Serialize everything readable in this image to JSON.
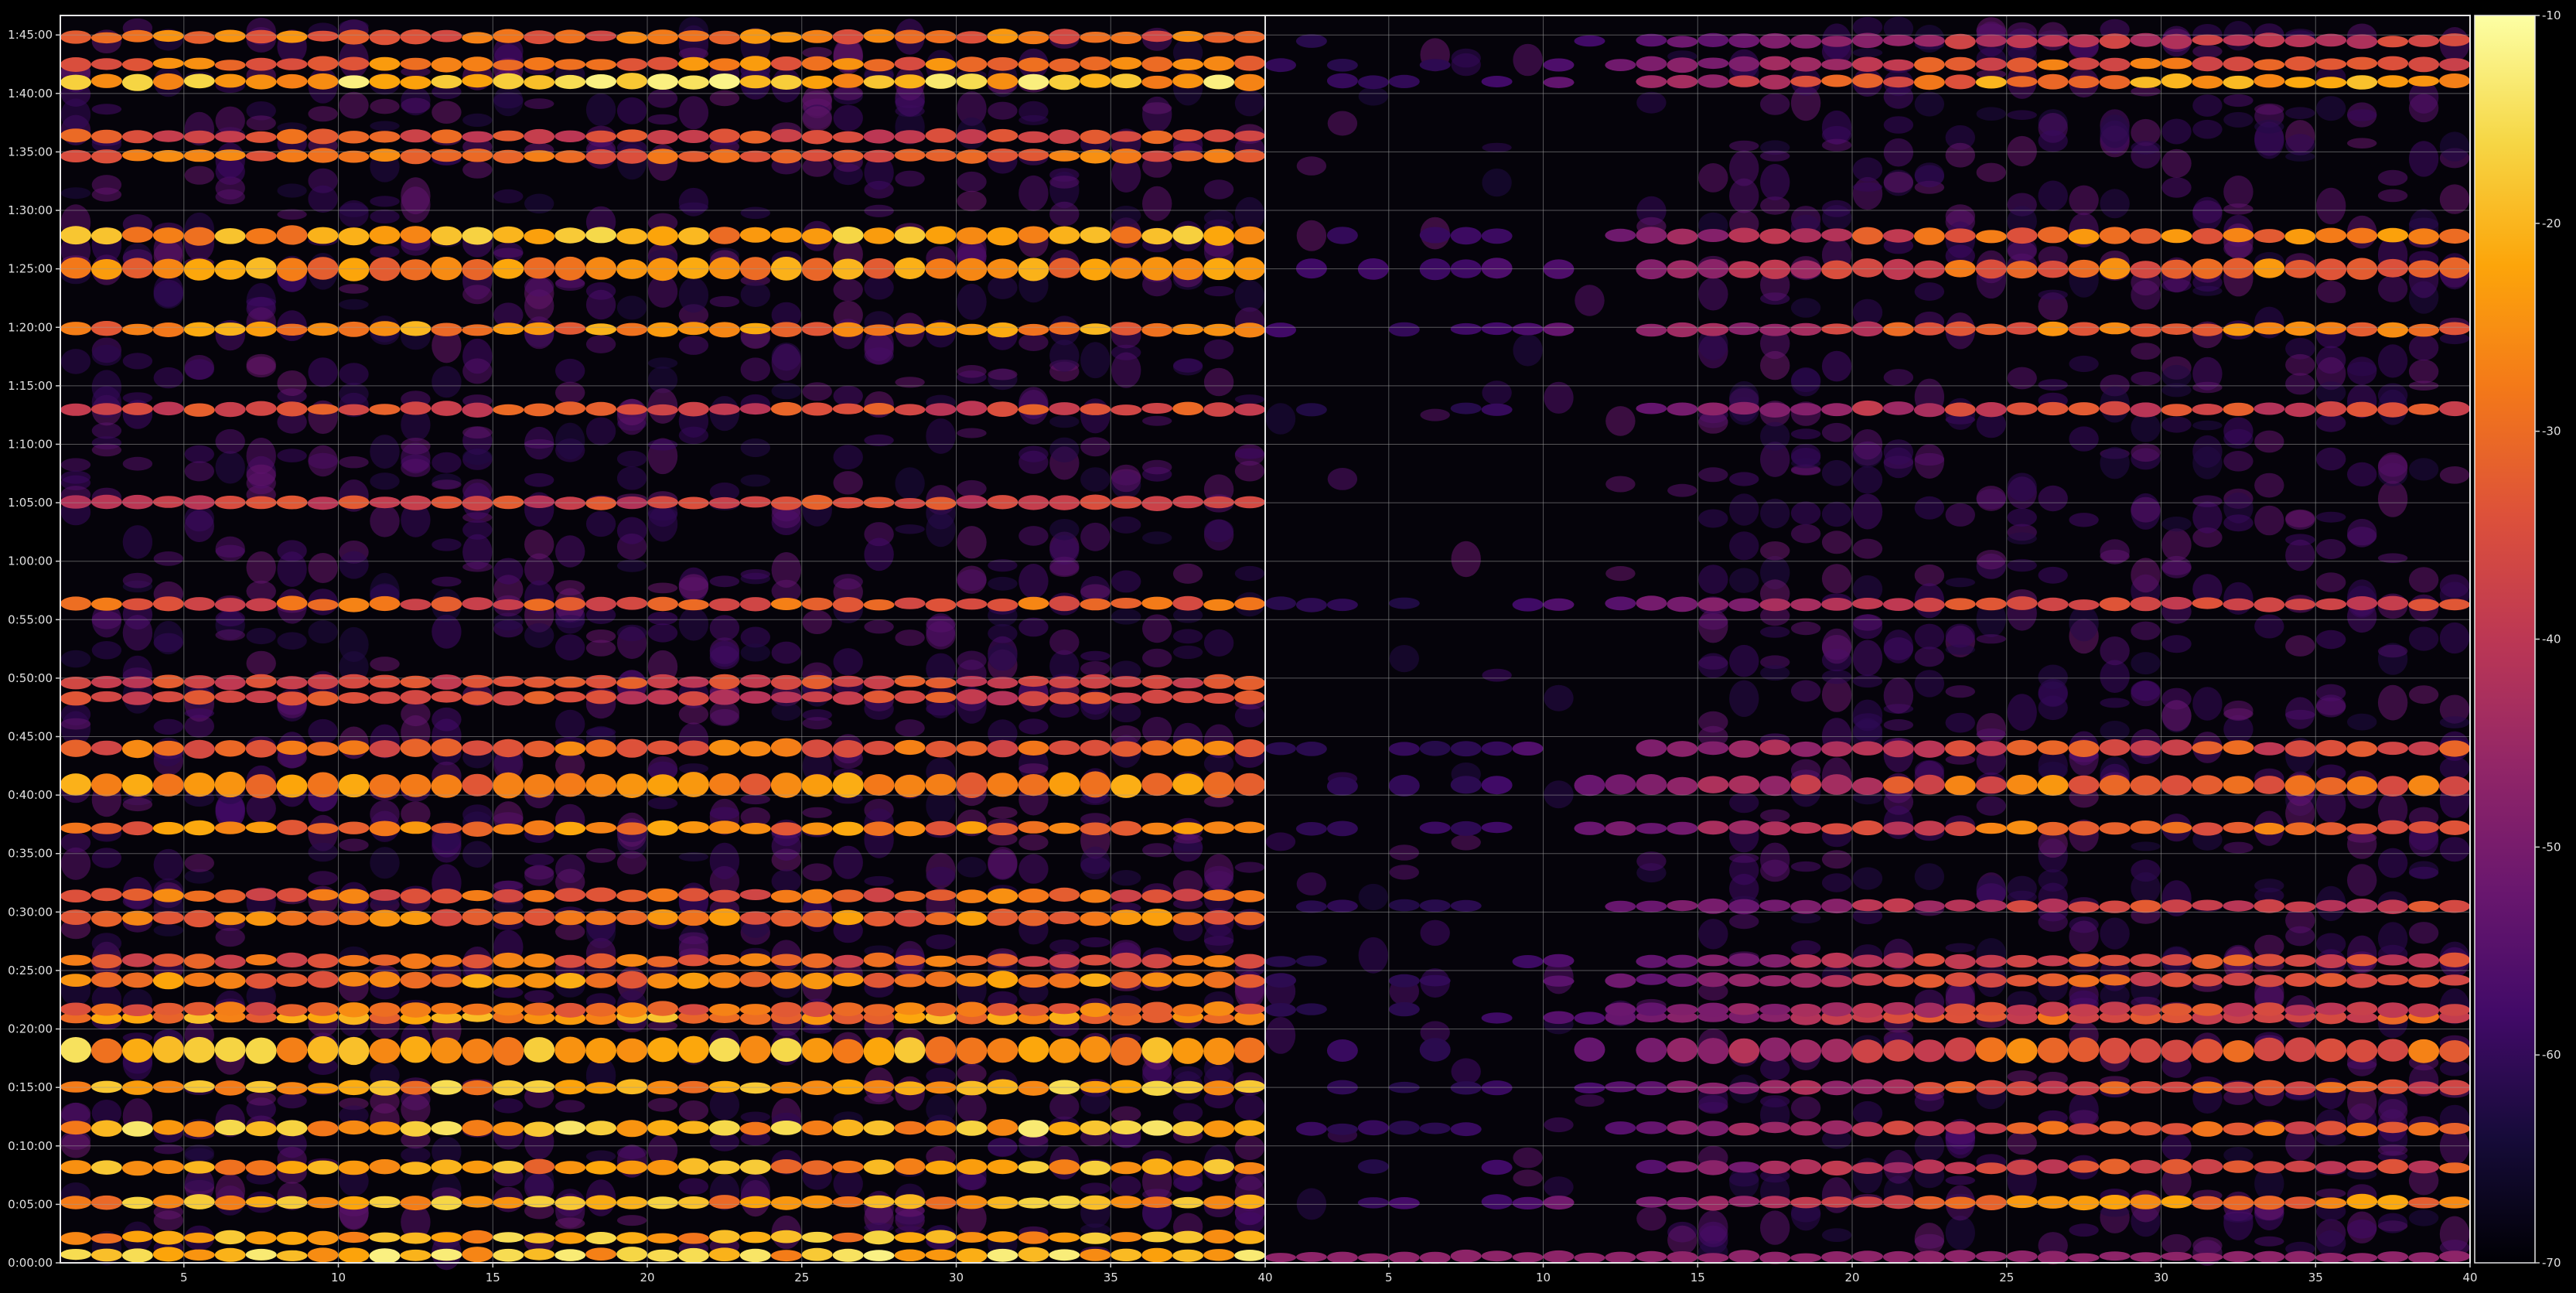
{
  "chart_data": {
    "type": "heatmap",
    "title": "",
    "xlabel": "",
    "ylabel": "",
    "grid": true,
    "panels": [
      {
        "name": "",
        "xlim": [
          1,
          40
        ],
        "xticks": [
          5,
          10,
          15,
          20,
          25,
          30,
          35,
          40
        ],
        "cols": 39,
        "bands": [
          {
            "t": 40,
            "w": 1.0,
            "i": 0.9
          },
          {
            "t": 130,
            "w": 0.9,
            "i": 0.86
          },
          {
            "t": 310,
            "w": 1.0,
            "i": 0.84
          },
          {
            "t": 490,
            "w": 1.1,
            "i": 0.82
          },
          {
            "t": 690,
            "w": 1.2,
            "i": 0.88
          },
          {
            "t": 900,
            "w": 1.0,
            "i": 0.85
          },
          {
            "t": 1090,
            "w": 2.2,
            "i": 0.86
          },
          {
            "t": 1260,
            "w": 1.0,
            "i": 0.8
          },
          {
            "t": 1300,
            "w": 1.0,
            "i": 0.7
          },
          {
            "t": 1450,
            "w": 1.2,
            "i": 0.76
          },
          {
            "t": 1550,
            "w": 1.0,
            "i": 0.68
          },
          {
            "t": 1770,
            "w": 1.2,
            "i": 0.74
          },
          {
            "t": 1885,
            "w": 1.0,
            "i": 0.7
          },
          {
            "t": 2230,
            "w": 1.0,
            "i": 0.75
          },
          {
            "t": 2450,
            "w": 2.0,
            "i": 0.78
          },
          {
            "t": 2640,
            "w": 1.3,
            "i": 0.7
          },
          {
            "t": 2900,
            "w": 1.0,
            "i": 0.6
          },
          {
            "t": 2980,
            "w": 1.0,
            "i": 0.62
          },
          {
            "t": 3380,
            "w": 1.0,
            "i": 0.68
          },
          {
            "t": 3900,
            "w": 1.0,
            "i": 0.6
          },
          {
            "t": 4380,
            "w": 1.0,
            "i": 0.62
          },
          {
            "t": 4790,
            "w": 1.0,
            "i": 0.78
          },
          {
            "t": 5100,
            "w": 1.8,
            "i": 0.8
          },
          {
            "t": 5270,
            "w": 1.4,
            "i": 0.84
          },
          {
            "t": 5680,
            "w": 1.0,
            "i": 0.7
          },
          {
            "t": 5780,
            "w": 1.0,
            "i": 0.64
          },
          {
            "t": 6060,
            "w": 1.2,
            "i": 0.9
          },
          {
            "t": 6150,
            "w": 1.0,
            "i": 0.74
          },
          {
            "t": 6290,
            "w": 1.0,
            "i": 0.72
          }
        ]
      },
      {
        "name": "",
        "xlim": [
          1,
          40
        ],
        "xticks": [
          5,
          10,
          15,
          20,
          25,
          30,
          35,
          40
        ],
        "cols": 39,
        "bands": [
          {
            "t": 30,
            "w": 0.8,
            "i": 0.55
          },
          {
            "t": 310,
            "w": 1.0,
            "i": 0.78
          },
          {
            "t": 490,
            "w": 1.0,
            "i": 0.62
          },
          {
            "t": 690,
            "w": 1.0,
            "i": 0.66
          },
          {
            "t": 900,
            "w": 1.0,
            "i": 0.64
          },
          {
            "t": 1090,
            "w": 2.0,
            "i": 0.7
          },
          {
            "t": 1260,
            "w": 1.0,
            "i": 0.66
          },
          {
            "t": 1300,
            "w": 1.0,
            "i": 0.6
          },
          {
            "t": 1450,
            "w": 1.0,
            "i": 0.66
          },
          {
            "t": 1550,
            "w": 1.0,
            "i": 0.62
          },
          {
            "t": 1830,
            "w": 1.0,
            "i": 0.58
          },
          {
            "t": 2230,
            "w": 1.0,
            "i": 0.7
          },
          {
            "t": 2450,
            "w": 1.6,
            "i": 0.72
          },
          {
            "t": 2640,
            "w": 1.2,
            "i": 0.64
          },
          {
            "t": 3380,
            "w": 1.0,
            "i": 0.62
          },
          {
            "t": 4380,
            "w": 1.0,
            "i": 0.6
          },
          {
            "t": 4790,
            "w": 1.0,
            "i": 0.74
          },
          {
            "t": 5100,
            "w": 1.6,
            "i": 0.72
          },
          {
            "t": 5270,
            "w": 1.2,
            "i": 0.74
          },
          {
            "t": 6060,
            "w": 1.0,
            "i": 0.8
          },
          {
            "t": 6150,
            "w": 1.0,
            "i": 0.68
          },
          {
            "t": 6270,
            "w": 1.0,
            "i": 0.56
          }
        ]
      }
    ],
    "ylim": [
      0,
      6400
    ],
    "yticks": [
      {
        "v": 0,
        "label": "0:00:00"
      },
      {
        "v": 300,
        "label": "0:05:00"
      },
      {
        "v": 600,
        "label": "0:10:00"
      },
      {
        "v": 900,
        "label": "0:15:00"
      },
      {
        "v": 1200,
        "label": "0:20:00"
      },
      {
        "v": 1500,
        "label": "0:25:00"
      },
      {
        "v": 1800,
        "label": "0:30:00"
      },
      {
        "v": 2100,
        "label": "0:35:00"
      },
      {
        "v": 2400,
        "label": "0:40:00"
      },
      {
        "v": 2700,
        "label": "0:45:00"
      },
      {
        "v": 3000,
        "label": "0:50:00"
      },
      {
        "v": 3300,
        "label": "0:55:00"
      },
      {
        "v": 3600,
        "label": "1:00:00"
      },
      {
        "v": 3900,
        "label": "1:05:00"
      },
      {
        "v": 4200,
        "label": "1:10:00"
      },
      {
        "v": 4500,
        "label": "1:15:00"
      },
      {
        "v": 4800,
        "label": "1:20:00"
      },
      {
        "v": 5100,
        "label": "1:25:00"
      },
      {
        "v": 5400,
        "label": "1:30:00"
      },
      {
        "v": 5700,
        "label": "1:35:00"
      },
      {
        "v": 6000,
        "label": "1:40:00"
      },
      {
        "v": 6300,
        "label": "1:45:00"
      }
    ],
    "colorbar": {
      "colormap": "inferno",
      "range": [
        -70,
        -10
      ],
      "ticks": [
        -10,
        -20,
        -30,
        -40,
        -50,
        -60,
        -70
      ]
    }
  }
}
